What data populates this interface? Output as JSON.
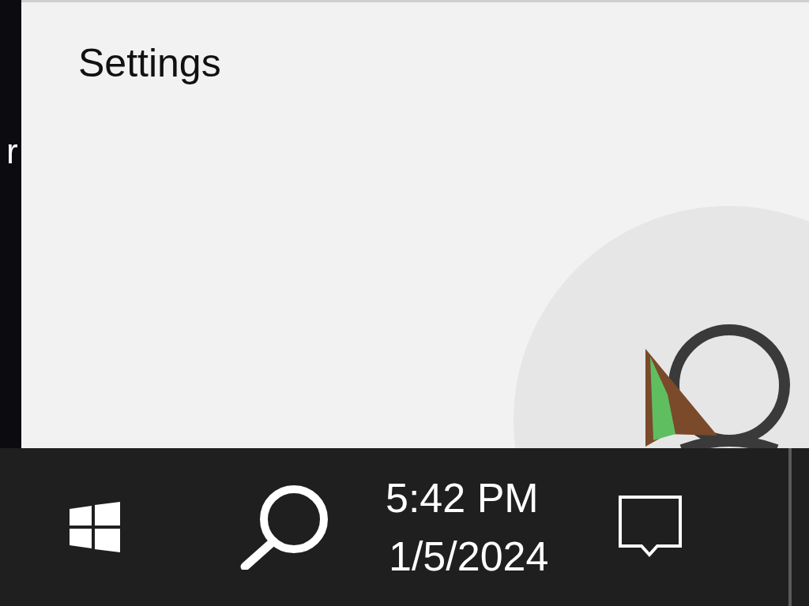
{
  "background_window": {
    "edge_text": "r"
  },
  "window": {
    "title": "Settings"
  },
  "taskbar": {
    "time": "5:42 PM",
    "date": "1/5/2024"
  }
}
